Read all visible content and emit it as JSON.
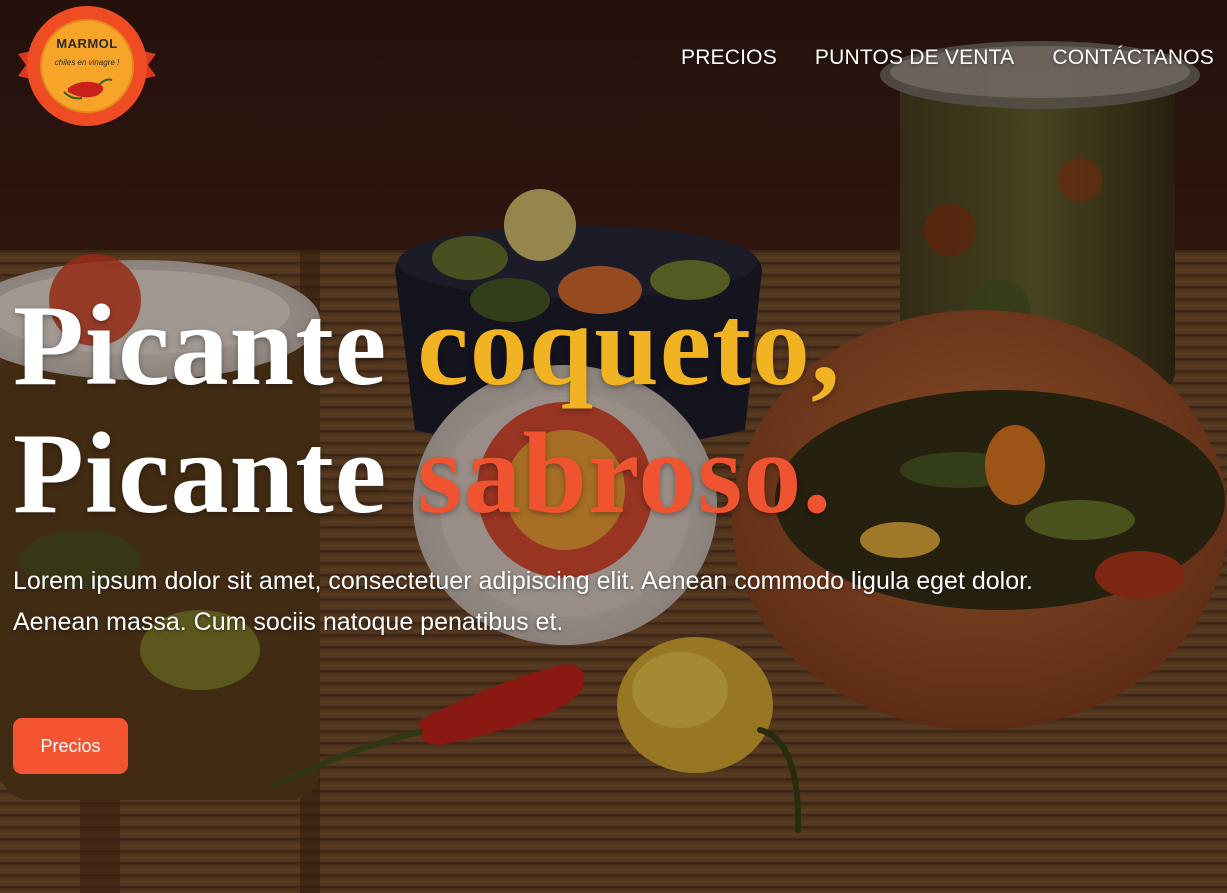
{
  "brand": {
    "name": "MARMOL",
    "tagline": "chiles en vinagre !"
  },
  "nav": {
    "items": [
      {
        "label": "PRECIOS"
      },
      {
        "label": "PUNTOS DE VENTA"
      },
      {
        "label": "CONTÁCTANOS"
      }
    ]
  },
  "hero": {
    "headline_line1_white": "Picante ",
    "headline_line1_accent": "coqueto,",
    "headline_line2_white": "Picante ",
    "headline_line2_accent": "sabroso.",
    "lead": "Lorem ipsum dolor sit amet, consectetuer adipiscing elit. Aenean commodo ligula eget dolor. Aenean massa. Cum sociis natoque penatibus et.",
    "cta_label": "Precios"
  },
  "colors": {
    "accent_yellow": "#f1b321",
    "accent_orange": "#f0532f",
    "button": "#f45431",
    "logo_ring": "#ef4c24",
    "logo_inner": "#f6a528"
  }
}
